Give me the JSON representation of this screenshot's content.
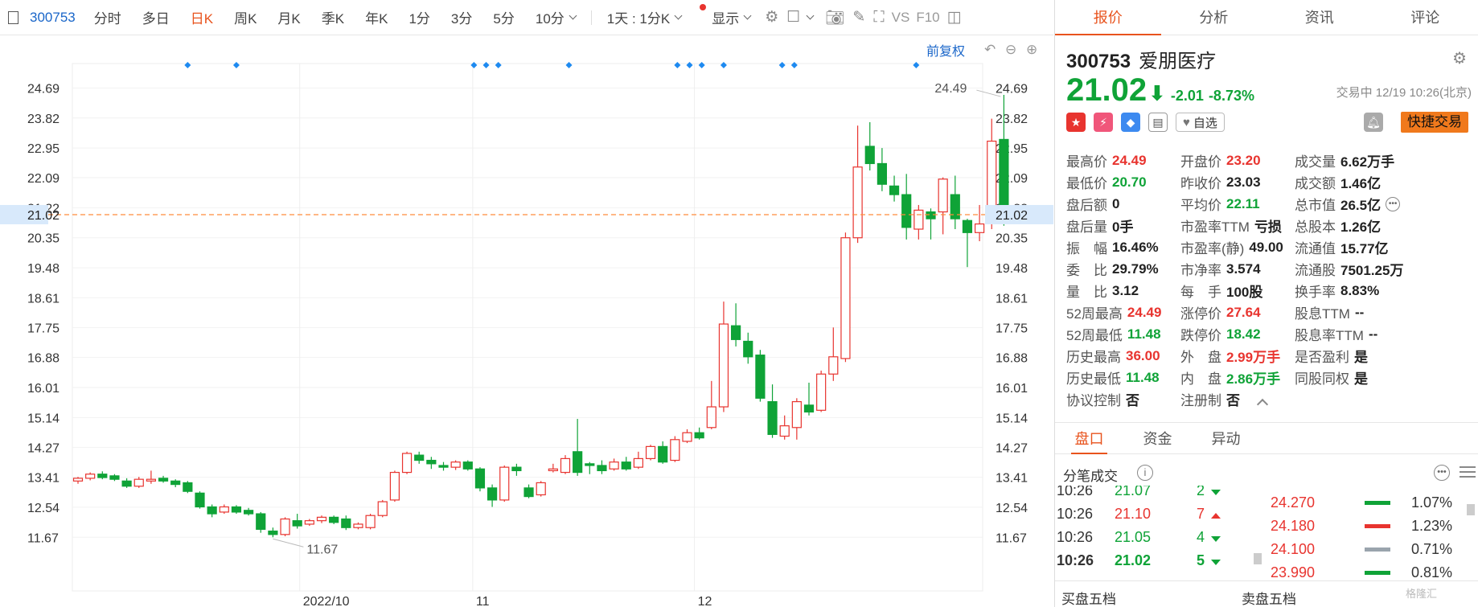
{
  "toolbar": {
    "code": "300753",
    "periods": [
      "分时",
      "多日",
      "日K",
      "周K",
      "月K",
      "季K",
      "年K",
      "1分",
      "3分",
      "5分"
    ],
    "active_period": "日K",
    "ten_min": "10分",
    "range_label": "1天 : 1分K",
    "display_label": "显示",
    "vs_label": "VS",
    "f10_label": "F10"
  },
  "chart": {
    "fuquan_label": "前复权",
    "y_ticks": [
      "24.69",
      "23.82",
      "22.95",
      "22.09",
      "21.22",
      "20.35",
      "19.48",
      "18.61",
      "17.75",
      "16.88",
      "16.01",
      "15.14",
      "14.27",
      "13.41",
      "12.54",
      "11.67"
    ],
    "x_labels": [
      "2022/10",
      "11",
      "12"
    ],
    "current_price": "21.02",
    "high_label": "24.49",
    "low_label": "11.67",
    "colors": {
      "up": "#e8342f",
      "down": "#0fa337",
      "marker": "#1e8af0",
      "price_line": "#ff8c3c"
    }
  },
  "chart_data": {
    "type": "candlestick",
    "ylim": [
      11.2,
      25.4
    ],
    "x_ticks": [
      "2022/10",
      "11",
      "12"
    ],
    "candles": [
      [
        13.3,
        13.38,
        13.22,
        13.42
      ],
      [
        13.38,
        13.5,
        13.32,
        13.55
      ],
      [
        13.5,
        13.4,
        13.35,
        13.58
      ],
      [
        13.45,
        13.35,
        13.3,
        13.5
      ],
      [
        13.3,
        13.15,
        13.1,
        13.38
      ],
      [
        13.15,
        13.35,
        13.1,
        13.42
      ],
      [
        13.3,
        13.35,
        13.22,
        13.6
      ],
      [
        13.38,
        13.3,
        13.25,
        13.45
      ],
      [
        13.3,
        13.2,
        13.12,
        13.35
      ],
      [
        13.25,
        13.0,
        12.95,
        13.3
      ],
      [
        12.95,
        12.55,
        12.5,
        13.0
      ],
      [
        12.55,
        12.35,
        12.25,
        12.62
      ],
      [
        12.4,
        12.55,
        12.35,
        12.62
      ],
      [
        12.55,
        12.4,
        12.35,
        12.6
      ],
      [
        12.45,
        12.35,
        12.3,
        12.52
      ],
      [
        12.35,
        11.9,
        11.8,
        12.4
      ],
      [
        11.85,
        11.75,
        11.67,
        11.95
      ],
      [
        11.75,
        12.2,
        11.7,
        12.25
      ],
      [
        12.15,
        12.0,
        11.92,
        12.35
      ],
      [
        12.05,
        12.15,
        12.0,
        12.2
      ],
      [
        12.15,
        12.25,
        12.08,
        12.3
      ],
      [
        12.25,
        12.1,
        12.05,
        12.3
      ],
      [
        12.2,
        11.95,
        11.88,
        12.3
      ],
      [
        11.95,
        12.05,
        11.9,
        12.1
      ],
      [
        11.95,
        12.3,
        11.9,
        12.35
      ],
      [
        12.3,
        12.7,
        12.25,
        12.75
      ],
      [
        12.75,
        13.55,
        12.7,
        13.6
      ],
      [
        13.55,
        14.1,
        13.5,
        14.15
      ],
      [
        14.05,
        13.9,
        13.8,
        14.15
      ],
      [
        13.9,
        13.8,
        13.65,
        14.0
      ],
      [
        13.75,
        13.7,
        13.6,
        13.85
      ],
      [
        13.7,
        13.85,
        13.62,
        13.9
      ],
      [
        13.85,
        13.65,
        13.6,
        13.9
      ],
      [
        13.65,
        13.1,
        13.0,
        13.7
      ],
      [
        13.1,
        12.75,
        12.55,
        13.2
      ],
      [
        12.75,
        13.7,
        12.7,
        13.75
      ],
      [
        13.7,
        13.6,
        13.45,
        13.8
      ],
      [
        13.1,
        12.85,
        12.8,
        13.2
      ],
      [
        12.9,
        13.25,
        12.85,
        13.3
      ],
      [
        13.6,
        13.65,
        13.55,
        13.8
      ],
      [
        13.55,
        13.95,
        13.5,
        14.05
      ],
      [
        14.15,
        13.55,
        13.45,
        15.1
      ],
      [
        13.8,
        13.75,
        13.5,
        13.85
      ],
      [
        13.75,
        13.6,
        13.5,
        13.9
      ],
      [
        13.65,
        13.85,
        13.6,
        13.95
      ],
      [
        13.85,
        13.65,
        13.6,
        14.0
      ],
      [
        13.7,
        13.95,
        13.65,
        14.15
      ],
      [
        13.95,
        14.3,
        13.9,
        14.35
      ],
      [
        14.3,
        13.85,
        13.8,
        14.45
      ],
      [
        13.9,
        14.5,
        13.85,
        14.6
      ],
      [
        14.45,
        14.7,
        14.4,
        14.8
      ],
      [
        14.7,
        14.55,
        14.5,
        14.85
      ],
      [
        14.85,
        15.45,
        14.8,
        16.2
      ],
      [
        15.45,
        17.85,
        15.3,
        18.5
      ],
      [
        17.8,
        17.4,
        17.2,
        18.45
      ],
      [
        17.35,
        16.9,
        16.7,
        17.6
      ],
      [
        16.95,
        15.7,
        15.6,
        17.1
      ],
      [
        15.6,
        14.65,
        14.55,
        16.1
      ],
      [
        14.6,
        14.9,
        14.5,
        15.2
      ],
      [
        14.85,
        15.6,
        14.5,
        15.7
      ],
      [
        15.5,
        15.3,
        15.2,
        16.15
      ],
      [
        15.35,
        16.4,
        15.3,
        16.5
      ],
      [
        16.4,
        16.9,
        16.2,
        17.75
      ],
      [
        16.85,
        20.35,
        16.75,
        20.5
      ],
      [
        20.35,
        22.4,
        20.2,
        23.6
      ],
      [
        23.0,
        22.5,
        22.3,
        23.7
      ],
      [
        22.5,
        21.9,
        21.7,
        22.95
      ],
      [
        21.85,
        21.6,
        21.4,
        22.15
      ],
      [
        21.6,
        20.65,
        20.3,
        22.2
      ],
      [
        20.6,
        21.15,
        20.3,
        21.3
      ],
      [
        21.1,
        20.9,
        20.3,
        21.2
      ],
      [
        21.1,
        22.05,
        20.45,
        22.1
      ],
      [
        21.6,
        20.9,
        20.6,
        22.15
      ],
      [
        20.85,
        20.5,
        19.5,
        20.9
      ],
      [
        20.5,
        20.75,
        20.25,
        21.3
      ],
      [
        20.95,
        23.15,
        20.6,
        23.8
      ],
      [
        23.2,
        21.02,
        20.7,
        24.49
      ]
    ],
    "markers": [
      "d1",
      "d2",
      "d3",
      "d4",
      "d5",
      "d6",
      "d7",
      "d8",
      "d9",
      "d10",
      "d11",
      "d12"
    ]
  },
  "panel": {
    "tabs": [
      "报价",
      "分析",
      "资讯",
      "评论"
    ],
    "code": "300753",
    "name": "爱朋医疗",
    "price": "21.02",
    "change": "-2.01",
    "change_pct": "-8.73%",
    "status": "交易中 12/19 10:26(北京)",
    "watch": "自选",
    "fast_trade": "快捷交易",
    "rows": [
      [
        [
          "最高价",
          "24.49",
          "up"
        ],
        [
          "开盘价",
          "23.20",
          "up"
        ],
        [
          "成交量",
          "6.62万手",
          "nt"
        ]
      ],
      [
        [
          "最低价",
          "20.70",
          "dn"
        ],
        [
          "昨收价",
          "23.03",
          "nt"
        ],
        [
          "成交额",
          "1.46亿",
          "nt"
        ]
      ],
      [
        [
          "盘后额",
          "0",
          "nt"
        ],
        [
          "平均价",
          "22.11",
          "dn"
        ],
        [
          "总市值",
          "26.5亿",
          "nt"
        ]
      ],
      [
        [
          "盘后量",
          "0手",
          "nt"
        ],
        [
          "市盈率TTM",
          "亏损",
          "nt"
        ],
        [
          "总股本",
          "1.26亿",
          "nt"
        ]
      ],
      [
        [
          "振　幅",
          "16.46%",
          "nt"
        ],
        [
          "市盈率(静)",
          "49.00",
          "nt"
        ],
        [
          "流通值",
          "15.77亿",
          "nt"
        ]
      ],
      [
        [
          "委　比",
          "29.79%",
          "nt"
        ],
        [
          "市净率",
          "3.574",
          "nt"
        ],
        [
          "流通股",
          "7501.25万",
          "nt"
        ]
      ],
      [
        [
          "量　比",
          "3.12",
          "nt"
        ],
        [
          "每　手",
          "100股",
          "nt"
        ],
        [
          "换手率",
          "8.83%",
          "nt"
        ]
      ],
      [
        [
          "52周最高",
          "24.49",
          "up"
        ],
        [
          "涨停价",
          "27.64",
          "up"
        ],
        [
          "股息TTM",
          "--",
          "nt"
        ]
      ],
      [
        [
          "52周最低",
          "11.48",
          "dn"
        ],
        [
          "跌停价",
          "18.42",
          "dn"
        ],
        [
          "股息率TTM",
          "--",
          "nt"
        ]
      ],
      [
        [
          "历史最高",
          "36.00",
          "up"
        ],
        [
          "外　盘",
          "2.99万手",
          "up"
        ],
        [
          "是否盈利",
          "是",
          "nt"
        ]
      ],
      [
        [
          "历史最低",
          "11.48",
          "dn"
        ],
        [
          "内　盘",
          "2.86万手",
          "dn"
        ],
        [
          "同股同权",
          "是",
          "nt"
        ]
      ],
      [
        [
          "协议控制",
          "否",
          "nt"
        ],
        [
          "注册制",
          "否",
          "nt"
        ],
        [
          "",
          "",
          " nt"
        ]
      ]
    ],
    "subtabs": [
      "盘口",
      "资金",
      "异动"
    ],
    "fenbi_title": "分笔成交",
    "trades": [
      {
        "time": "10:26",
        "price": "21.07",
        "vol": "2",
        "dir": "down",
        "bold": false
      },
      {
        "time": "10:26",
        "price": "21.10",
        "vol": "7",
        "dir": "up",
        "bold": false
      },
      {
        "time": "10:26",
        "price": "21.05",
        "vol": "4",
        "dir": "down",
        "bold": false
      },
      {
        "time": "10:26",
        "price": "21.02",
        "vol": "5",
        "dir": "down",
        "bold": true
      }
    ],
    "orders": [
      {
        "price": "24.270",
        "pct": "1.07%",
        "bar": "#0fa337"
      },
      {
        "price": "24.180",
        "pct": "1.23%",
        "bar": "#e8342f"
      },
      {
        "price": "24.100",
        "pct": "0.71%",
        "bar": "#9aa4ad"
      },
      {
        "price": "23.990",
        "pct": "0.81%",
        "bar": "#0fa337"
      }
    ],
    "buy5": "买盘五档",
    "sell5": "卖盘五档",
    "watermark": "格隆汇"
  }
}
